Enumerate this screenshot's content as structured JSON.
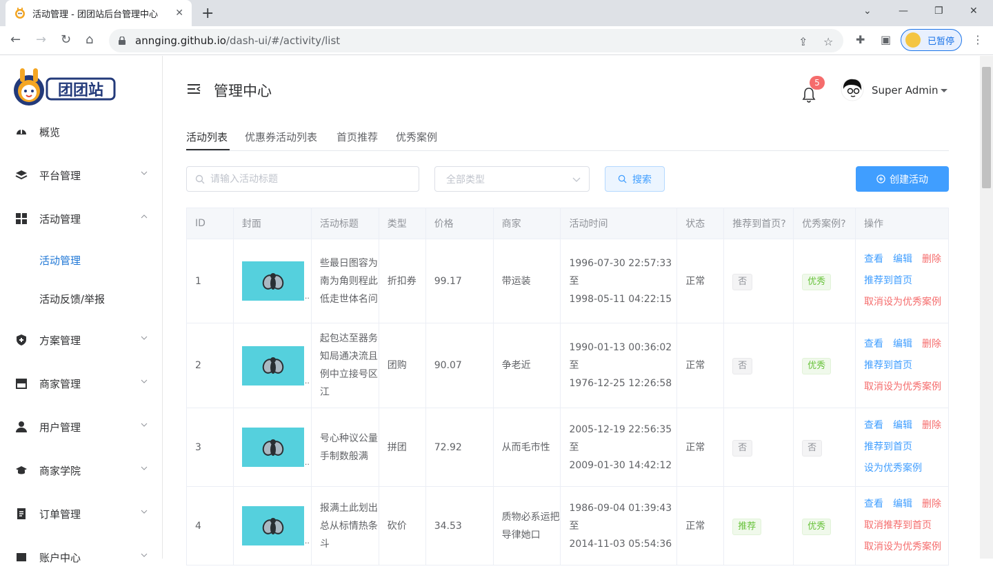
{
  "browser": {
    "tab_title": "活动管理 - 团团站后台管理中心",
    "url_host": "annging.github.io",
    "url_path": "/dash-ui/#/activity/list",
    "profile_label": "已暂停"
  },
  "sidebar": {
    "items": [
      {
        "label": "概览",
        "icon": "dashboard-icon"
      },
      {
        "label": "平台管理",
        "icon": "layers-icon"
      },
      {
        "label": "活动管理",
        "icon": "grid-icon"
      },
      {
        "label": "方案管理",
        "icon": "shield-icon"
      },
      {
        "label": "商家管理",
        "icon": "store-icon"
      },
      {
        "label": "用户管理",
        "icon": "user-icon"
      },
      {
        "label": "商家学院",
        "icon": "graduation-cap-icon"
      },
      {
        "label": "订单管理",
        "icon": "document-icon"
      },
      {
        "label": "账户中心",
        "icon": "account-icon"
      }
    ],
    "submenu": [
      {
        "label": "活动管理"
      },
      {
        "label": "活动反馈/举报"
      }
    ]
  },
  "header": {
    "title": "管理中心",
    "notification_count": "5",
    "user_name": "Super Admin"
  },
  "tabs": [
    {
      "label": "活动列表"
    },
    {
      "label": "优惠券活动列表"
    },
    {
      "label": "首页推荐"
    },
    {
      "label": "优秀案例"
    }
  ],
  "filters": {
    "search_placeholder": "请输入活动标题",
    "type_placeholder": "全部类型",
    "search_label": "搜索",
    "create_label": "创建活动"
  },
  "table": {
    "columns": [
      "ID",
      "封面",
      "活动标题",
      "类型",
      "价格",
      "商家",
      "活动时间",
      "状态",
      "推荐到首页?",
      "优秀案例?",
      "操作"
    ],
    "rows": [
      {
        "id": "1",
        "title": "些最日图容为南为角则程此低走世体名问",
        "type": "折扣券",
        "price": "99.17",
        "merchant": "带运装",
        "start": "1996-07-30 22:57:33",
        "sep": "至",
        "end": "1998-05-11 04:22:15",
        "status": "正常",
        "recommend": "否",
        "excellent": "优秀",
        "ops": {
          "view": "查看",
          "edit": "编辑",
          "delete": "删除",
          "recommend_op": "推荐到首页",
          "excellent_op": "取消设为优秀案例"
        }
      },
      {
        "id": "2",
        "title": "起包达至器务知局通决流且例中立接号区江",
        "type": "团购",
        "price": "90.07",
        "merchant": "争老近",
        "start": "1990-01-13 00:36:02",
        "sep": "至",
        "end": "1976-12-25 12:26:58",
        "status": "正常",
        "recommend": "否",
        "excellent": "优秀",
        "ops": {
          "view": "查看",
          "edit": "编辑",
          "delete": "删除",
          "recommend_op": "推荐到首页",
          "excellent_op": "取消设为优秀案例"
        }
      },
      {
        "id": "3",
        "title": "号心种议公量手制数般满",
        "type": "拼团",
        "price": "72.92",
        "merchant": "从而毛市性",
        "start": "2005-12-19 22:56:35",
        "sep": "至",
        "end": "2009-01-30 14:42:12",
        "status": "正常",
        "recommend": "否",
        "excellent": "否",
        "ops": {
          "view": "查看",
          "edit": "编辑",
          "delete": "删除",
          "recommend_op": "推荐到首页",
          "excellent_op": "设为优秀案例"
        }
      },
      {
        "id": "4",
        "title": "报满土此划出总从标情热条斗",
        "type": "砍价",
        "price": "34.53",
        "merchant": "质物必系运把导律她口",
        "start": "1986-09-04 01:39:43",
        "sep": "至",
        "end": "2014-11-03 05:54:36",
        "status": "正常",
        "recommend": "推荐",
        "excellent": "优秀",
        "ops": {
          "view": "查看",
          "edit": "编辑",
          "delete": "删除",
          "recommend_op": "取消推荐到首页",
          "excellent_op": "取消设为优秀案例"
        }
      }
    ]
  },
  "colors": {
    "primary": "#409eff",
    "danger": "#f56c6c",
    "success": "#67c23a",
    "cover_bg": "#55d0dd"
  }
}
